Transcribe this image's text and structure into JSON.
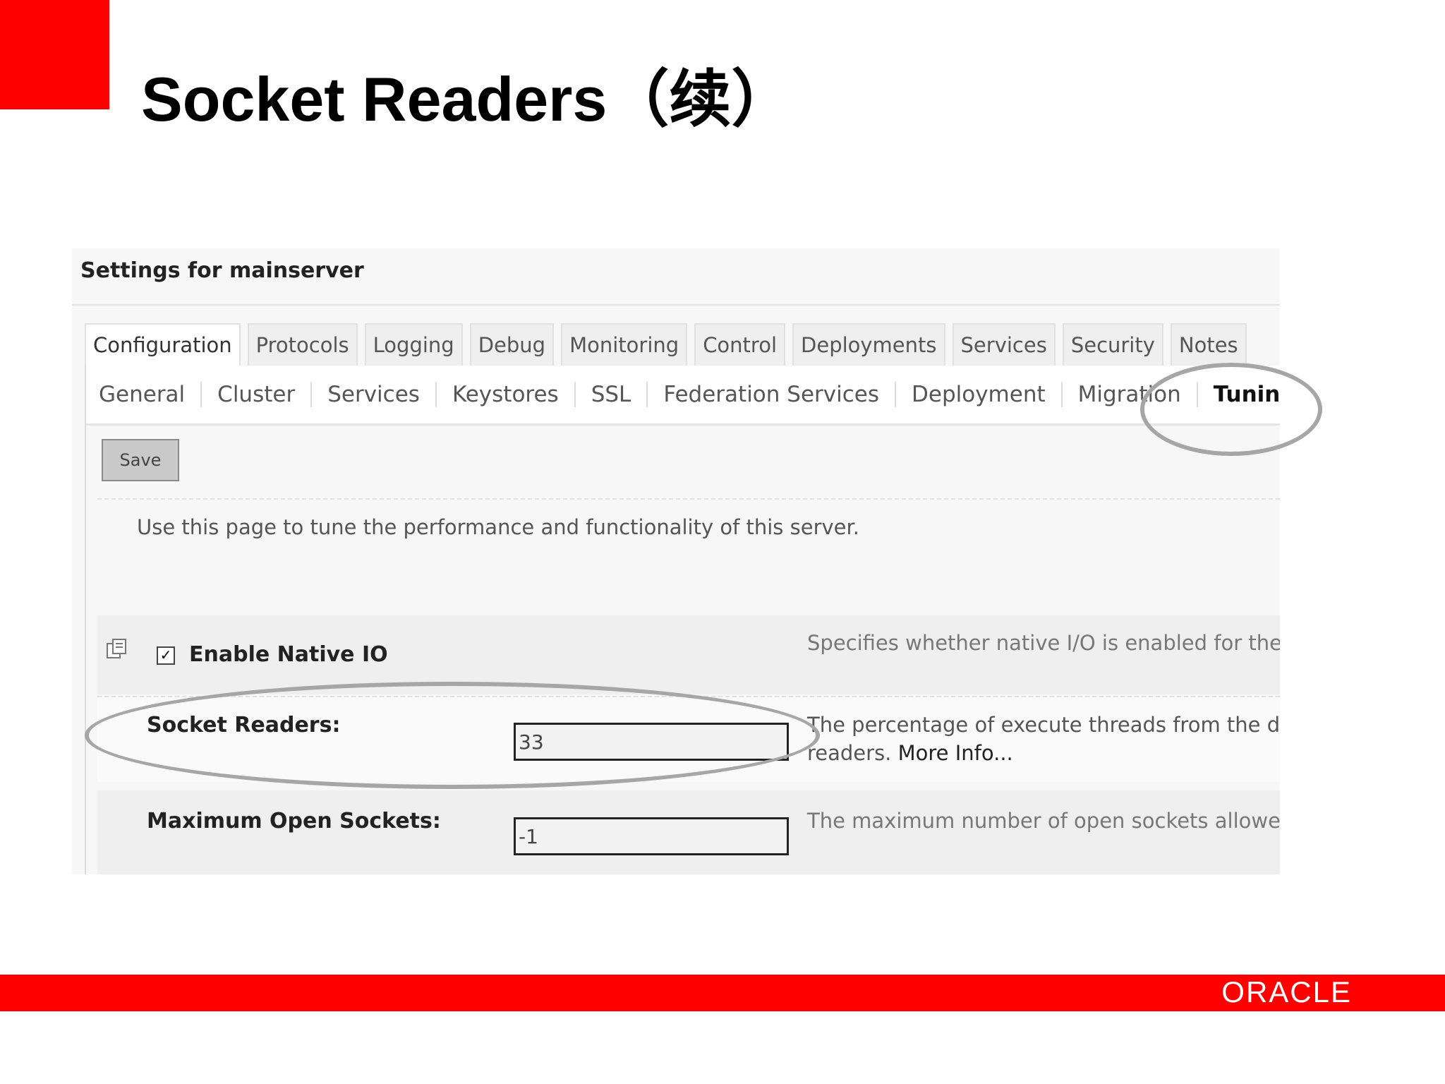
{
  "slide": {
    "title": "Socket Readers（续）",
    "logo_text": "ORACLE",
    "brand_color": "#ff0000"
  },
  "console": {
    "settings_title": "Settings for mainserver",
    "tabs": [
      {
        "label": "Configuration",
        "active": true
      },
      {
        "label": "Protocols",
        "active": false
      },
      {
        "label": "Logging",
        "active": false
      },
      {
        "label": "Debug",
        "active": false
      },
      {
        "label": "Monitoring",
        "active": false
      },
      {
        "label": "Control",
        "active": false
      },
      {
        "label": "Deployments",
        "active": false
      },
      {
        "label": "Services",
        "active": false
      },
      {
        "label": "Security",
        "active": false
      },
      {
        "label": "Notes",
        "active": false
      }
    ],
    "subtabs": [
      {
        "label": "General",
        "active": false
      },
      {
        "label": "Cluster",
        "active": false
      },
      {
        "label": "Services",
        "active": false
      },
      {
        "label": "Keystores",
        "active": false
      },
      {
        "label": "SSL",
        "active": false
      },
      {
        "label": "Federation Services",
        "active": false
      },
      {
        "label": "Deployment",
        "active": false
      },
      {
        "label": "Migration",
        "active": false
      },
      {
        "label": "Tuning",
        "active": true
      }
    ],
    "save_label": "Save",
    "description": "Use this page to tune the performance and functionality of this server.",
    "fields": {
      "native_io": {
        "label": "Enable Native IO",
        "checked": true,
        "help": "Specifies whether native I/O is enabled for the s"
      },
      "socket_readers": {
        "label": "Socket Readers:",
        "value": "33",
        "help_line1": "The percentage of execute threads from the def",
        "help_line2": "readers.",
        "more_info": "More Info..."
      },
      "max_open_sockets": {
        "label": "Maximum Open Sockets:",
        "value": "-1",
        "help": "The maximum number of open sockets allowed"
      }
    }
  }
}
